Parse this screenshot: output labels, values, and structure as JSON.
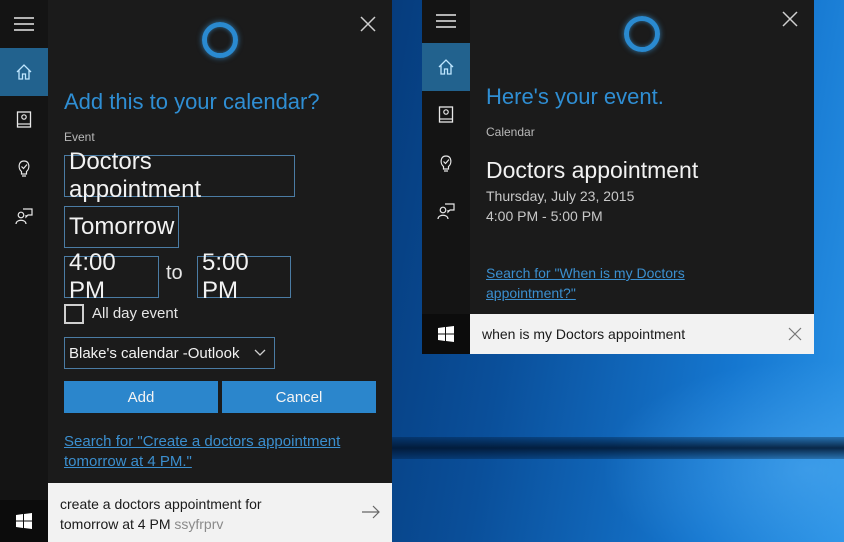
{
  "colors": {
    "accent": "#2b86cc",
    "headline": "#2f8ed3",
    "panel_bg": "#1b1b1b",
    "rail_bg": "#141414",
    "rail_active": "#22628e",
    "field_border": "#4b7ca4",
    "search_bg": "#f2f2f2"
  },
  "left_panel": {
    "rail": {
      "menu_icon": "hamburger-icon",
      "items": [
        {
          "name": "home",
          "icon": "home-icon",
          "active": true
        },
        {
          "name": "notebook",
          "icon": "notebook-icon",
          "active": false
        },
        {
          "name": "reminders",
          "icon": "lightbulb-icon",
          "active": false
        },
        {
          "name": "feedback",
          "icon": "feedback-icon",
          "active": false
        }
      ]
    },
    "headline": "Add this to your calendar?",
    "event_label": "Event",
    "event_title_value": "Doctors appointment",
    "date_value": "Tomorrow",
    "start_time_value": "4:00 PM",
    "to_label": "to",
    "end_time_value": "5:00 PM",
    "all_day_label": "All day event",
    "all_day_checked": false,
    "calendar_selected": "Blake's calendar -Outlook",
    "add_button": "Add",
    "cancel_button": "Cancel",
    "search_link_line1": "Search for \"Create a doctors appointment",
    "search_link_line2": "tomorrow at 4 PM.\"",
    "search_query_line1": "create a doctors appointment for",
    "search_query_line2": "tomorrow at 4 PM",
    "search_query_suffix": "ssyfrprv"
  },
  "right_panel": {
    "rail": {
      "menu_icon": "hamburger-icon",
      "items": [
        {
          "name": "home",
          "icon": "home-icon",
          "active": true
        },
        {
          "name": "notebook",
          "icon": "notebook-icon",
          "active": false
        },
        {
          "name": "reminders",
          "icon": "lightbulb-icon",
          "active": false
        },
        {
          "name": "feedback",
          "icon": "feedback-icon",
          "active": false
        }
      ]
    },
    "headline": "Here's your event.",
    "calendar_label": "Calendar",
    "event_title": "Doctors appointment",
    "event_date": "Thursday, July 23, 2015",
    "event_time": "4:00 PM - 5:00 PM",
    "search_link_line1": "Search for \"When is my Doctors",
    "search_link_line2": "appointment?\"",
    "search_query": "when is my Doctors appointment"
  }
}
